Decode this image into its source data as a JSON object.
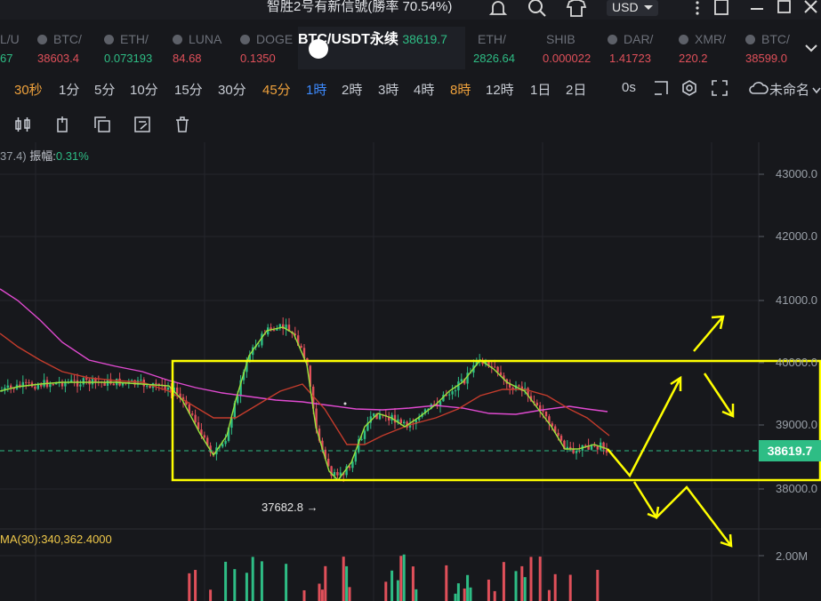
{
  "window": {
    "title": "智胜2号有新信號(勝率 70.54%)",
    "currency": "USD"
  },
  "tickers": [
    {
      "symbol": "L/U",
      "price": "67",
      "trend": "up"
    },
    {
      "symbol": "BTC/",
      "price": "38603.4",
      "trend": "down"
    },
    {
      "symbol": "ETH/",
      "price": "0.073193",
      "trend": "up"
    },
    {
      "symbol": "LUNA",
      "price": "84.68",
      "trend": "down"
    },
    {
      "symbol": "DOGE",
      "price": "0.1350",
      "trend": "down"
    },
    {
      "symbol": "ETH/",
      "price": "2826.64",
      "trend": "up"
    },
    {
      "symbol": "SHIB",
      "price": "0.000022",
      "trend": "down"
    },
    {
      "symbol": "DAR/",
      "price": "1.41723",
      "trend": "down"
    },
    {
      "symbol": "XMR/",
      "price": "220.2",
      "trend": "down"
    },
    {
      "symbol": "BTC/",
      "price": "38599.0",
      "trend": "down"
    }
  ],
  "active_ticker": {
    "symbol": "BTC/USDT永续",
    "price": "38619.7"
  },
  "intervals": [
    {
      "label": "30秒",
      "style": "orange"
    },
    {
      "label": "1分",
      "style": "normal"
    },
    {
      "label": "5分",
      "style": "normal"
    },
    {
      "label": "10分",
      "style": "normal"
    },
    {
      "label": "15分",
      "style": "normal"
    },
    {
      "label": "30分",
      "style": "normal"
    },
    {
      "label": "45分",
      "style": "orange"
    },
    {
      "label": "1時",
      "style": "active"
    },
    {
      "label": "2時",
      "style": "normal"
    },
    {
      "label": "3時",
      "style": "normal"
    },
    {
      "label": "4時",
      "style": "normal"
    },
    {
      "label": "8時",
      "style": "orange"
    },
    {
      "label": "12時",
      "style": "normal"
    },
    {
      "label": "1日",
      "style": "normal"
    },
    {
      "label": "2日",
      "style": "normal"
    }
  ],
  "toolbar_right": {
    "countdown": "0s",
    "layout_name": "未命名"
  },
  "tools": [
    "candles-icon",
    "copy-icon",
    "duplicate-icon",
    "edit-icon",
    "trash-icon"
  ],
  "chart_info": {
    "prefix": "37.4)",
    "amplitude_label": "振幅:",
    "amplitude_value": "0.31%"
  },
  "volume_label": "MA(30):340,362.4000",
  "current_price": "38619.7",
  "low_marker": "37682.8",
  "low_arrow": "→",
  "chart_data": {
    "type": "candlestick",
    "timeframe": "1時",
    "y_ticks": [
      "43000.0",
      "42000.0",
      "41000.0",
      "40000.0",
      "39000.0",
      "38000.0"
    ],
    "ylim": [
      37500,
      43300
    ],
    "current_price": 38619.7,
    "low": 37682.8,
    "volume_tick": "2.00M",
    "range_box": {
      "high": 40000,
      "low": 38130
    },
    "colors": {
      "up": "#2ebd85",
      "down": "#e0505a",
      "ma_fast": "#9be33c",
      "ma_mid": "#c43c2c",
      "ma_slow": "#e04ad0",
      "annotation": "#ffff00"
    }
  }
}
